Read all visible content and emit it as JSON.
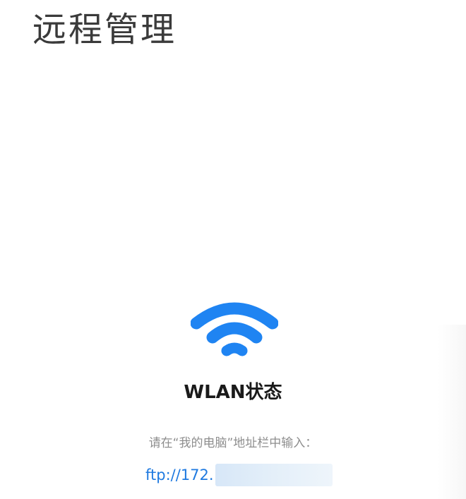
{
  "page": {
    "title": "远程管理"
  },
  "status": {
    "icon": "wifi-icon",
    "title": "WLAN状态",
    "accent_color": "#1f7ae0"
  },
  "instructions": {
    "text": "请在“我的电脑”地址栏中输入：",
    "ftp_address_visible": "ftp://172."
  }
}
